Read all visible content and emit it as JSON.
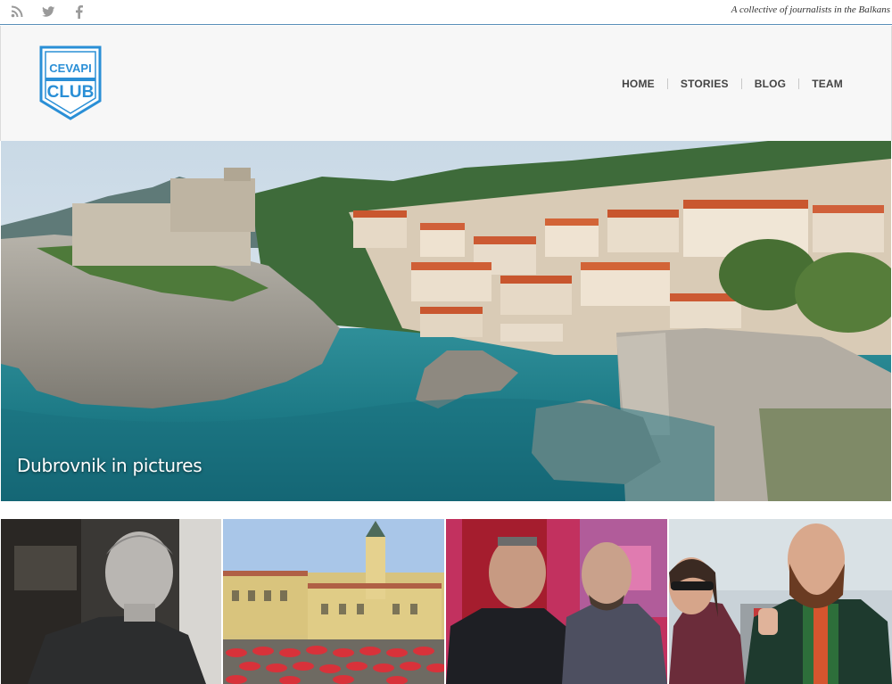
{
  "topbar": {
    "social_icons": [
      "rss-icon",
      "twitter-icon",
      "facebook-icon"
    ],
    "tagline": "A collective of journalists in the Balkans"
  },
  "header": {
    "logo": {
      "line1": "CEVAPI",
      "line2": "CLUB",
      "color": "#2a8fd6"
    },
    "nav": [
      "HOME",
      "STORIES",
      "BLOG",
      "TEAM"
    ]
  },
  "hero": {
    "caption": "Dubrovnik in pictures"
  },
  "thumbnails": [
    {
      "subject": "portrait-man-grey-hair"
    },
    {
      "subject": "zagreb-market-umbrellas"
    },
    {
      "subject": "two-men-in-bar"
    },
    {
      "subject": "bearded-man-and-woman-outdoors"
    }
  ],
  "colors": {
    "accent_blue": "#2a8fd6",
    "nav_text": "#444444",
    "header_bg": "#f7f7f7",
    "topbar_border": "#5a8fb8"
  }
}
